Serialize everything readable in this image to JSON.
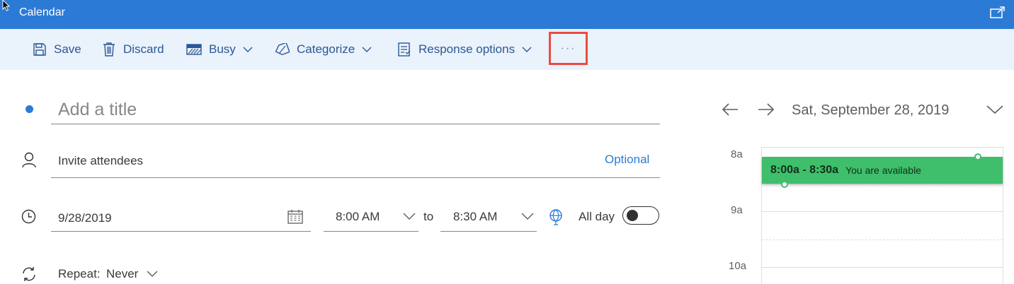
{
  "window": {
    "title": "Calendar"
  },
  "toolbar": {
    "save_label": "Save",
    "discard_label": "Discard",
    "busy_label": "Busy",
    "categorize_label": "Categorize",
    "response_options_label": "Response options",
    "more_label": "···"
  },
  "form": {
    "title_placeholder": "Add a title",
    "attendees_placeholder": "Invite attendees",
    "optional_label": "Optional",
    "date_value": "9/28/2019",
    "start_time": "8:00 AM",
    "to_label": "to",
    "end_time": "8:30 AM",
    "all_day_label": "All day",
    "all_day_on": false,
    "repeat_label": "Repeat:",
    "repeat_value": "Never"
  },
  "day_view": {
    "date_label": "Sat, September 28, 2019",
    "hours": [
      "8a",
      "9a",
      "10a"
    ],
    "event": {
      "time": "8:00a - 8:30a",
      "status": "You are available"
    }
  },
  "colors": {
    "titlebar": "#2b7bd6",
    "toolbar_bg": "#eaf2fb",
    "event": "#3fbf6b",
    "highlight": "#ea4c43"
  }
}
